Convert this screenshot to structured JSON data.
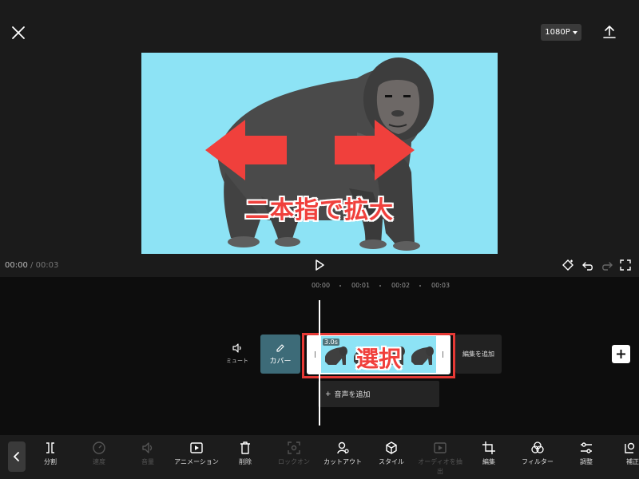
{
  "header": {
    "resolution": "1080P"
  },
  "video": {
    "overlay_text": "二本指で拡大"
  },
  "playback": {
    "current_time": "00:00",
    "separator": "/",
    "total_time": "00:03"
  },
  "ruler": {
    "labels": [
      "00:00",
      "00:01",
      "00:02",
      "00:03"
    ]
  },
  "timeline": {
    "mute_label": "ミュート",
    "cover_label": "カバー",
    "clip_duration": "3.0s",
    "selection_label": "選択",
    "add_edit_label": "編集を追加",
    "add_audio_label": "音声を追加",
    "add_audio_prefix": "+"
  },
  "toolbar": {
    "items": [
      {
        "label": "分割",
        "icon": "split-icon",
        "enabled": true
      },
      {
        "label": "速度",
        "icon": "speed-icon",
        "enabled": false
      },
      {
        "label": "音量",
        "icon": "volume-icon",
        "enabled": false
      },
      {
        "label": "アニメーション",
        "icon": "animation-icon",
        "enabled": true
      },
      {
        "label": "削除",
        "icon": "trash-icon",
        "enabled": true
      },
      {
        "label": "ロックオン",
        "icon": "lock-on-icon",
        "enabled": false
      },
      {
        "label": "カットアウト",
        "icon": "cutout-icon",
        "enabled": true
      },
      {
        "label": "スタイル",
        "icon": "style-icon",
        "enabled": true
      },
      {
        "label": "オーディオを抽出",
        "icon": "extract-audio-icon",
        "enabled": false
      },
      {
        "label": "編集",
        "icon": "crop-icon",
        "enabled": true
      },
      {
        "label": "フィルター",
        "icon": "filter-icon",
        "enabled": true
      },
      {
        "label": "調整",
        "icon": "adjust-icon",
        "enabled": true
      },
      {
        "label": "補正",
        "icon": "enhance-icon",
        "enabled": true
      }
    ]
  },
  "colors": {
    "accent_red": "#e53935",
    "sky_blue": "#8de3f5",
    "cover_teal": "#3d6b78"
  }
}
